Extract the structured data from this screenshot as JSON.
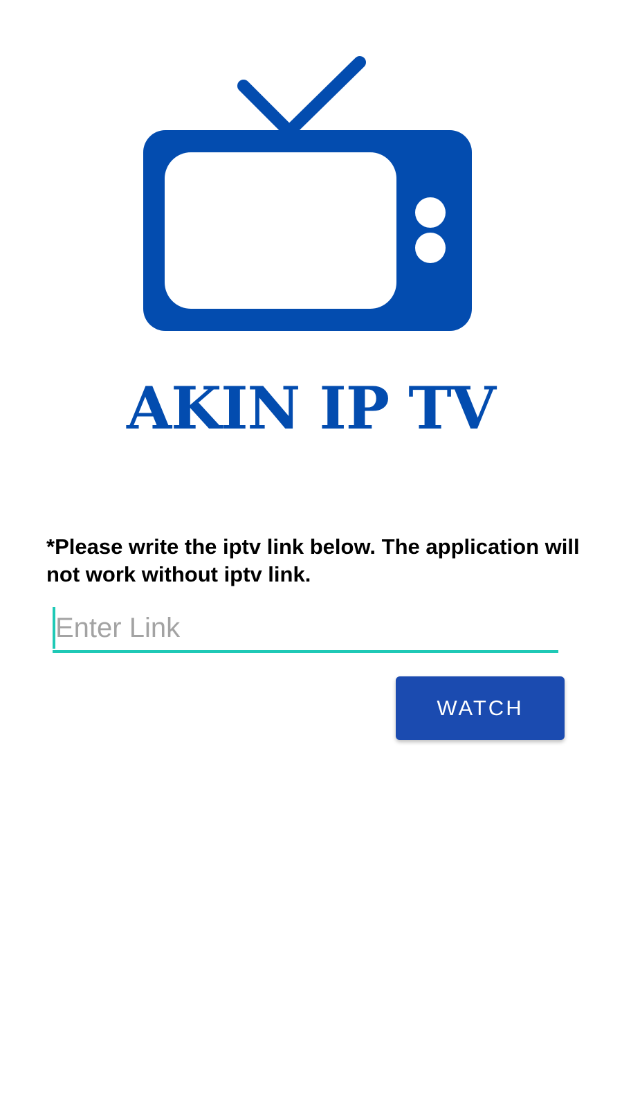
{
  "app": {
    "brand_name": "AKIN IP TV",
    "brand_color": "#034CAF",
    "logo_icon": "tv-icon"
  },
  "form": {
    "instructions": "*Please write the iptv link below. The application will not work without iptv link.",
    "link_placeholder": "Enter Link",
    "link_value": "",
    "accent_color": "#1FC9B6",
    "watch_label": "WATCH",
    "button_color": "#1B4BB0"
  }
}
